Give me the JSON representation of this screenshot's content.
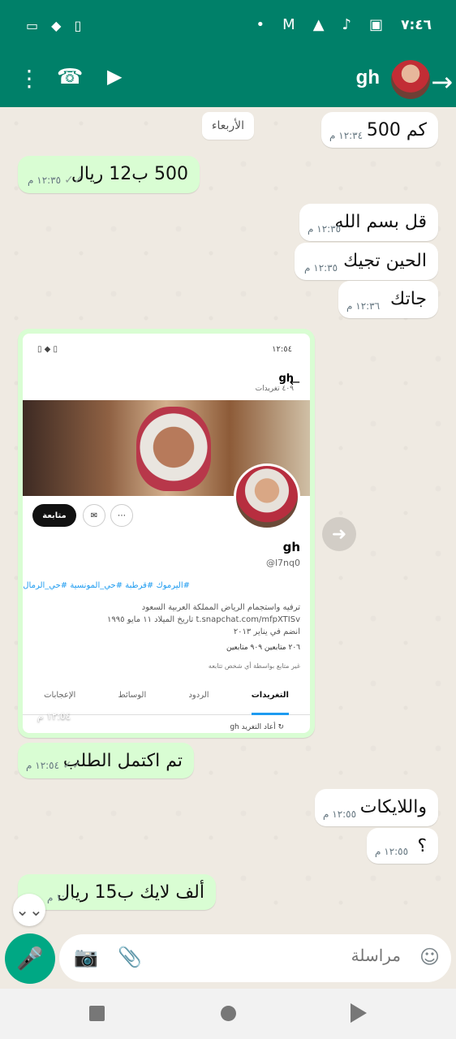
{
  "status_bar": {
    "time": "٧:٤٦",
    "icons": [
      "battery-icon",
      "wifi-icon",
      "vibrate-icon",
      "dot-icon",
      "gmail-icon",
      "warning-icon",
      "tiktok-icon",
      "app-icon"
    ]
  },
  "app_bar": {
    "contact_name": "gh",
    "icons": [
      "menu-icon",
      "phone-icon",
      "video-icon",
      "back-icon"
    ]
  },
  "date_separator": "الأربعاء",
  "messages": [
    {
      "text": "كم 500",
      "time": "١٢:٣٤ م",
      "direction": "incoming"
    },
    {
      "text": "500 ب12 ريال",
      "time": "١٢:٣٥ م",
      "direction": "outgoing"
    },
    {
      "text": "قل بسم الله",
      "time": "١٢:٣٥ م",
      "direction": "incoming"
    },
    {
      "text": "الحين تجيك",
      "time": "١٢:٣٥ م",
      "direction": "incoming"
    },
    {
      "text": "جاتك",
      "time": "١٢:٣٦ م",
      "direction": "incoming"
    },
    {
      "text": "تم اكتمل الطلب",
      "time": "١٢:٥٤ م",
      "direction": "outgoing"
    },
    {
      "text": "واللايكات",
      "time": "١٢:٥٥ م",
      "direction": "incoming"
    },
    {
      "text": "؟",
      "time": "١٢:٥٥ م",
      "direction": "incoming"
    },
    {
      "text": "ألف لايك ب15 ريال",
      "time": "١:٠٠ م",
      "direction": "outgoing"
    }
  ],
  "screenshot": {
    "status_time": "١٢:٥٤",
    "profile_name": "gh",
    "profile_posts": "٤٠٩ تغريدات",
    "follow_label": "متابعة",
    "profile_handle": "@l7nq0",
    "hashtags": "#اليرموك #قرطبة #حي_المونسية #حي_الرمال",
    "info_line1": "ترفيه واستجمام    الرياض المملكة العربية السعود",
    "info_line2": "t.snapchat.com/mfpXTISv    تاريخ الميلاد ١١ مايو ١٩٩٥",
    "info_line3": "انضم في يناير ٢٠١٣",
    "counts": "٢٠٦ متابعين   ٩٠٩ متابعين",
    "note": "غير متابع بواسطة أي شخص تتابعه",
    "tabs": [
      "التغريدات",
      "الردود",
      "الوسائط",
      "الإعجابات"
    ],
    "retweet_label": "أعاد التغريد gh",
    "time": "١٢:٥٤ م"
  },
  "composer": {
    "placeholder": "مراسلة"
  }
}
